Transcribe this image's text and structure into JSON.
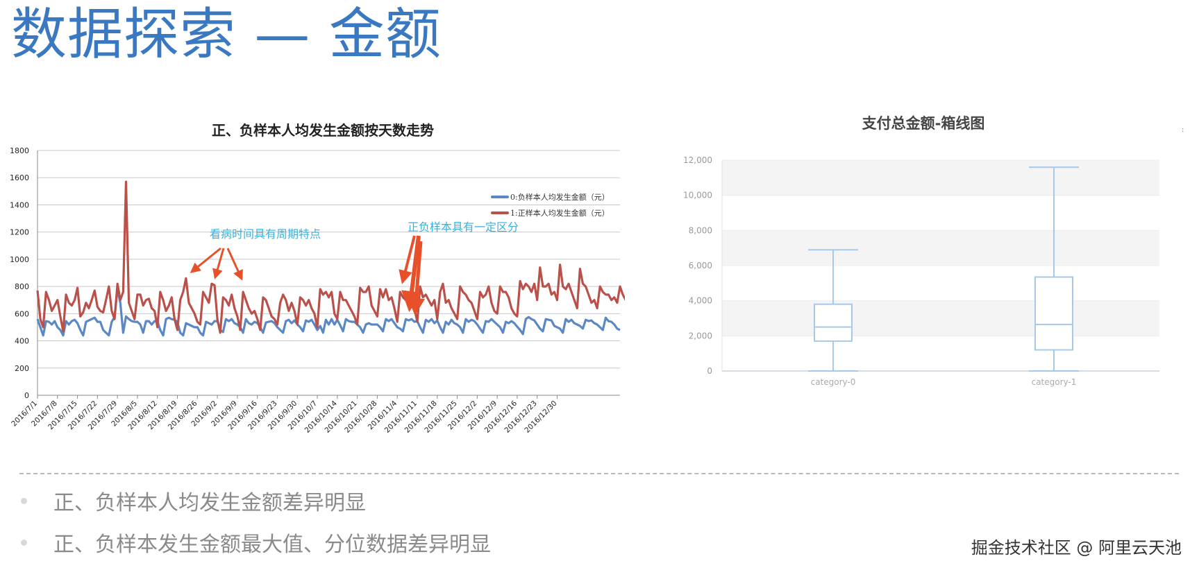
{
  "page": {
    "title": "数据探索 — 金额",
    "bullets": [
      "正、负样本人均发生金额差异明显",
      "正、负样本发生金额最大值、分位数据差异明显"
    ],
    "watermark": "掘金技术社区 @ 阿里云天池",
    "corner_mark": ":"
  },
  "colors": {
    "title": "#3a79c1",
    "negative_series": "#5b87c4",
    "positive_series": "#b9504a",
    "annotation_text": "#3ab0dc",
    "annotation_arrow": "#e8502a",
    "box_stroke": "#a8c8ea"
  },
  "chart_data": [
    {
      "type": "line",
      "title": "正、负样本人均发生金额按天数走势",
      "xlabel": "",
      "ylabel": "",
      "ylim": [
        0,
        1800
      ],
      "yticks": [
        0,
        200,
        400,
        600,
        800,
        1000,
        1200,
        1400,
        1600,
        1800
      ],
      "grid": true,
      "legend_position": "top-right",
      "x_start": "2016/7/1",
      "x_end": "2016/12/31",
      "tick_labels": [
        "2016/7/1",
        "2016/7/8",
        "2016/7/15",
        "2016/7/22",
        "2016/7/29",
        "2016/8/5",
        "2016/8/12",
        "2016/8/19",
        "2016/8/26",
        "2016/9/2",
        "2016/9/9",
        "2016/9/16",
        "2016/9/23",
        "2016/9/30",
        "2016/10/7",
        "2016/10/14",
        "2016/10/21",
        "2016/10/28",
        "2016/11/4",
        "2016/11/11",
        "2016/11/18",
        "2016/11/25",
        "2016/12/2",
        "2016/12/9",
        "2016/12/16",
        "2016/12/23",
        "2016/12/30"
      ],
      "series": [
        {
          "name": "0:负样本人均发生金额（元）",
          "values": [
            560,
            500,
            440,
            545,
            540,
            520,
            545,
            500,
            480,
            440,
            545,
            520,
            545,
            555,
            530,
            480,
            440,
            540,
            550,
            560,
            570,
            540,
            540,
            480,
            460,
            440,
            540,
            575,
            780,
            680,
            460,
            580,
            560,
            545,
            540,
            540,
            520,
            460,
            545,
            545,
            520,
            545,
            545,
            480,
            440,
            560,
            570,
            560,
            555,
            540,
            460,
            440,
            530,
            520,
            510,
            500,
            500,
            460,
            440,
            540,
            530,
            520,
            545,
            545,
            480,
            465,
            560,
            545,
            560,
            530,
            520,
            500,
            460,
            560,
            530,
            520,
            540,
            530,
            500,
            460,
            535,
            540,
            545,
            530,
            500,
            480,
            460,
            545,
            555,
            530,
            550,
            520,
            500,
            470,
            550,
            540,
            555,
            520,
            480,
            510,
            460,
            555,
            520,
            560,
            520,
            555,
            515,
            470,
            560,
            545,
            540,
            540,
            520,
            500,
            460,
            520,
            530,
            520,
            520,
            520,
            500,
            470,
            560,
            545,
            560,
            530,
            500,
            490,
            470,
            560,
            550,
            560,
            540,
            545,
            500,
            460,
            555,
            540,
            560,
            530,
            550,
            500,
            460,
            540,
            520,
            555,
            530,
            520,
            500,
            460,
            560,
            540,
            555,
            545,
            520,
            490,
            460,
            545,
            540,
            560,
            540,
            520,
            500,
            460,
            540,
            530,
            545,
            530,
            505,
            480,
            450,
            560,
            575,
            560,
            550,
            520,
            490,
            470,
            560,
            555,
            550,
            510,
            500,
            490,
            460,
            560,
            540,
            555,
            530,
            520,
            510,
            490,
            555,
            545,
            550,
            530,
            520,
            500,
            480,
            570,
            545,
            540,
            520,
            490,
            480
          ],
          "color": "#5b87c4"
        },
        {
          "name": "1:正样本人均发生金额（元）",
          "values": [
            770,
            560,
            500,
            760,
            700,
            620,
            660,
            700,
            580,
            470,
            740,
            680,
            660,
            700,
            790,
            580,
            610,
            680,
            640,
            700,
            770,
            650,
            620,
            610,
            700,
            800,
            620,
            560,
            820,
            700,
            760,
            1570,
            680,
            620,
            560,
            740,
            740,
            660,
            700,
            710,
            640,
            620,
            500,
            760,
            700,
            620,
            660,
            720,
            560,
            480,
            700,
            760,
            860,
            680,
            640,
            600,
            540,
            520,
            760,
            720,
            680,
            820,
            810,
            560,
            460,
            720,
            700,
            660,
            740,
            640,
            580,
            480,
            760,
            700,
            640,
            600,
            620,
            560,
            480,
            720,
            700,
            640,
            580,
            560,
            520,
            680,
            740,
            700,
            620,
            680,
            620,
            520,
            720,
            700,
            660,
            700,
            640,
            600,
            500,
            780,
            740,
            760,
            720,
            760,
            600,
            560,
            760,
            700,
            700,
            660,
            620,
            580,
            520,
            790,
            760,
            760,
            800,
            660,
            620,
            580,
            780,
            720,
            780,
            700,
            720,
            640,
            540,
            760,
            720,
            700,
            700,
            720,
            640,
            540,
            800,
            720,
            740,
            700,
            660,
            700,
            560,
            760,
            820,
            680,
            700,
            640,
            600,
            560,
            800,
            760,
            740,
            700,
            680,
            620,
            560,
            760,
            720,
            740,
            800,
            680,
            620,
            600,
            800,
            760,
            760,
            720,
            640,
            600,
            580,
            840,
            780,
            820,
            800,
            760,
            820,
            700,
            940,
            800,
            800,
            820,
            740,
            760,
            700,
            960,
            800,
            780,
            820,
            760,
            700,
            640,
            930,
            820,
            800,
            740,
            680,
            700,
            640,
            800,
            760,
            740,
            740,
            700,
            720,
            680,
            800,
            740,
            700,
            660,
            740,
            680,
            660
          ],
          "color": "#b9504a"
        }
      ],
      "annotations": [
        "看病时间具有周期特点",
        "正负样本具有一定区分"
      ]
    },
    {
      "type": "boxplot",
      "title": "支付总金额-箱线图",
      "xlabel": "",
      "ylabel": "",
      "ylim": [
        0,
        12000
      ],
      "yticks": [
        "0",
        "2,000",
        "4,000",
        "6,000",
        "8,000",
        "10,000",
        "12,000"
      ],
      "grid": true,
      "categories": [
        "category-0",
        "category-1"
      ],
      "boxes": [
        {
          "category": "category-0",
          "min": 0,
          "q1": 1700,
          "median": 2500,
          "q3": 3800,
          "max": 6900
        },
        {
          "category": "category-1",
          "min": 0,
          "q1": 1200,
          "median": 2650,
          "q3": 5350,
          "max": 11600
        }
      ]
    }
  ]
}
